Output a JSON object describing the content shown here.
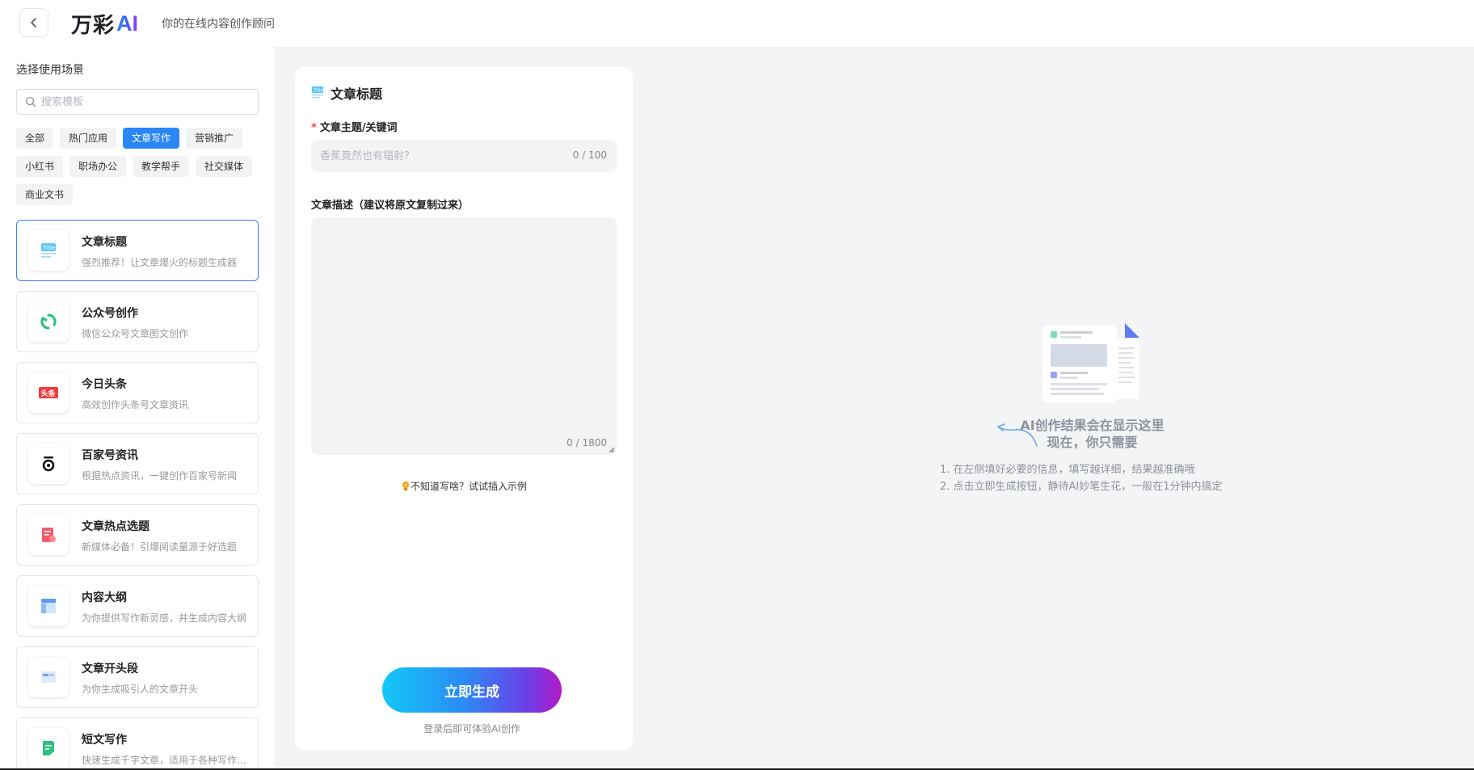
{
  "header": {
    "back_label": "返回",
    "logo_text": "万彩",
    "logo_ai": "AI",
    "subtitle": "你的在线内容创作顾问"
  },
  "sidebar": {
    "title": "选择使用场景",
    "search_placeholder": "搜索模板",
    "tags_rows": [
      [
        {
          "label": "全部",
          "active": false
        },
        {
          "label": "热门应用",
          "active": false
        },
        {
          "label": "文章写作",
          "active": true
        },
        {
          "label": "营销推广",
          "active": false
        }
      ],
      [
        {
          "label": "小红书",
          "active": false
        },
        {
          "label": "职场办公",
          "active": false
        },
        {
          "label": "教学帮手",
          "active": false
        },
        {
          "label": "社交媒体",
          "active": false
        }
      ],
      [
        {
          "label": "商业文书",
          "active": false
        }
      ]
    ],
    "cards": [
      {
        "title": "文章标题",
        "desc": "强烈推荐！让文章爆火的标题生成器",
        "icon": "title-icon",
        "active": true
      },
      {
        "title": "公众号创作",
        "desc": "微信公众号文章图文创作",
        "icon": "wechat-official-icon",
        "active": false
      },
      {
        "title": "今日头条",
        "desc": "高效创作头条号文章资讯",
        "icon": "toutiao-icon",
        "active": false
      },
      {
        "title": "百家号资讯",
        "desc": "根据热点资讯，一键创作百家号新闻",
        "icon": "baijiahao-icon",
        "active": false
      },
      {
        "title": "文章热点选题",
        "desc": "新媒体必备！引爆阅读量源于好选题",
        "icon": "hot-topic-icon",
        "active": false
      },
      {
        "title": "内容大纲",
        "desc": "为你提供写作新灵感，并生成内容大纲",
        "icon": "outline-icon",
        "active": false
      },
      {
        "title": "文章开头段",
        "desc": "为你生成吸引人的文章开头",
        "icon": "opening-icon",
        "active": false
      },
      {
        "title": "短文写作",
        "desc": "快速生成千字文章，适用于各种写作场景",
        "icon": "short-writing-icon",
        "active": false
      }
    ]
  },
  "form": {
    "title": "文章标题",
    "field1_required": "*",
    "field1_label": "文章主题/关键词",
    "field1_placeholder": "香蕉竟然也有辐射?",
    "field1_count": "0 / 100",
    "field2_label": "文章描述（建议将原文复制过来）",
    "field2_count": "0 / 1800",
    "hint": "不知道写啥？试试插入示例",
    "generate_label": "立即生成",
    "login_note": "登录后即可体验AI创作"
  },
  "result": {
    "title_line1": "AI创作结果会在显示这里",
    "title_line2": "现在，你只需要",
    "step1": "1. 在左侧填好必要的信息，填写越详细，结果越准确哦",
    "step2": "2. 点击立即生成按钮，静待AI妙笔生花，一般在1分钟内搞定"
  },
  "colors": {
    "accent": "#2a87f5",
    "background": "#f3f4f6",
    "required": "#f0463c"
  }
}
